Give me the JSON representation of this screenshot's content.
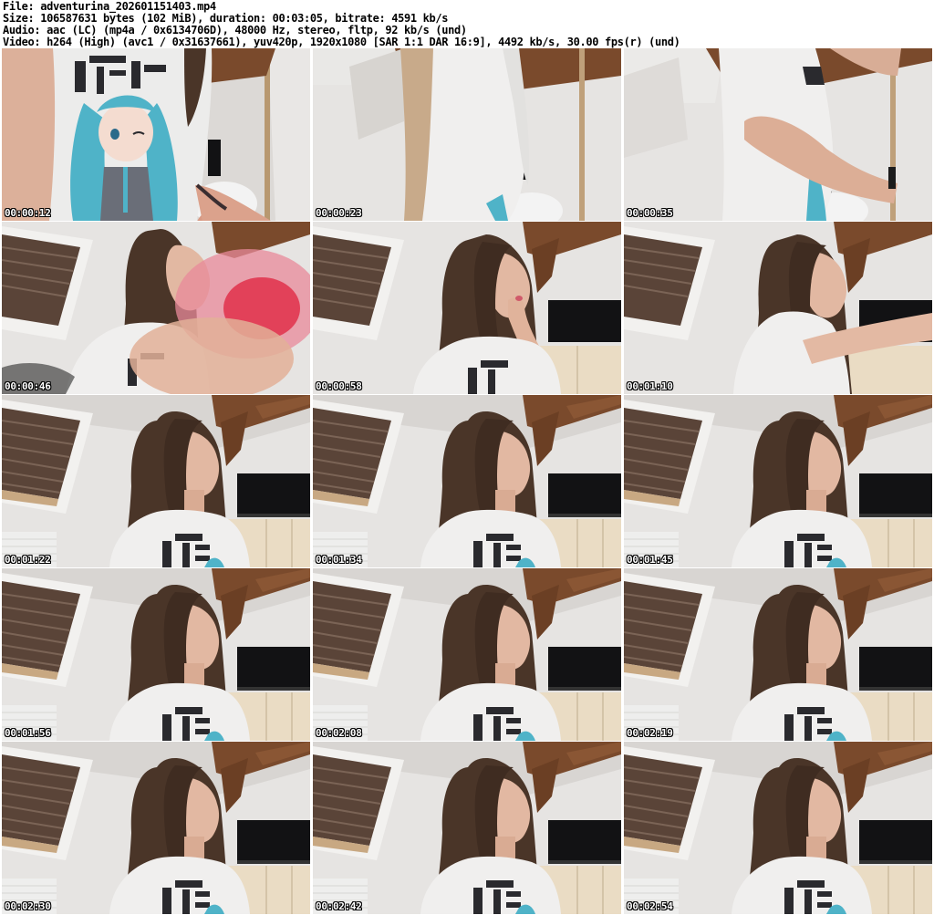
{
  "file_info": {
    "file": "File: adventurina_202601151403.mp4",
    "size": "Size: 106587631 bytes (102 MiB), duration: 00:03:05, bitrate: 4591 kb/s",
    "audio": "Audio: aac (LC) (mp4a / 0x6134706D), 48000 Hz, stereo, fltp, 92 kb/s (und)",
    "video": "Video: h264 (High) (avc1 / 0x31637661), yuv420p, 1920x1080 [SAR 1:1 DAR 16:9], 4492 kb/s, 30.00 fps(r) (und)"
  },
  "thumbnails": [
    {
      "timestamp": "00:00:12",
      "scene": "closeup-shirt-print"
    },
    {
      "timestamp": "00:00:23",
      "scene": "closeup-side"
    },
    {
      "timestamp": "00:00:35",
      "scene": "closeup-arm"
    },
    {
      "timestamp": "00:00:46",
      "scene": "room-blurred-hand"
    },
    {
      "timestamp": "00:00:58",
      "scene": "room-hand-chin"
    },
    {
      "timestamp": "00:01:10",
      "scene": "room-arm-reach"
    },
    {
      "timestamp": "00:01:22",
      "scene": "room-portrait"
    },
    {
      "timestamp": "00:01:34",
      "scene": "room-portrait"
    },
    {
      "timestamp": "00:01:45",
      "scene": "room-portrait"
    },
    {
      "timestamp": "00:01:56",
      "scene": "room-portrait"
    },
    {
      "timestamp": "00:02:08",
      "scene": "room-portrait"
    },
    {
      "timestamp": "00:02:19",
      "scene": "room-portrait"
    },
    {
      "timestamp": "00:02:30",
      "scene": "room-portrait"
    },
    {
      "timestamp": "00:02:42",
      "scene": "room-portrait"
    },
    {
      "timestamp": "00:02:54",
      "scene": "room-portrait"
    }
  ],
  "colors": {
    "wall": "#e4e2e0",
    "beam": "#7a4a2c",
    "blind": "#5a4438",
    "hair": "#4a3528",
    "skin": "#e2b8a2",
    "shirt": "#f0efee",
    "print": "#2a2a2e",
    "monitor": "#121214",
    "cabinet": "#eadcc4",
    "teal_hair": "#4fb3c8"
  }
}
